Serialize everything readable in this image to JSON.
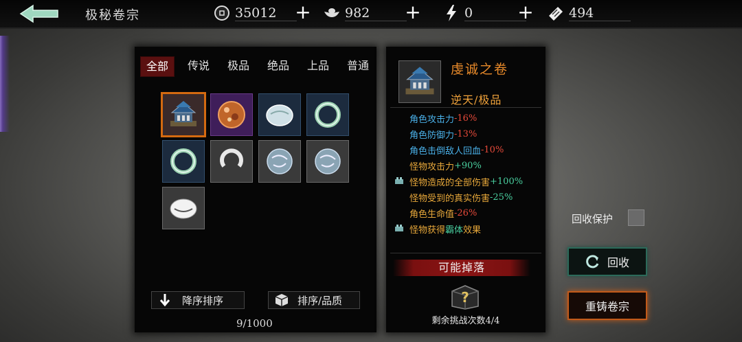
{
  "header": {
    "title": "极秘卷宗",
    "back_icon": "back-arrow-icon",
    "resources": [
      {
        "icon": "coin-icon",
        "value": "35012"
      },
      {
        "icon": "silver-ingot-icon",
        "value": "982"
      },
      {
        "icon": "lightning-icon",
        "value": "0"
      },
      {
        "icon": "ticket-icon",
        "value": "494"
      }
    ]
  },
  "inventory": {
    "tabs": [
      "全部",
      "传说",
      "极品",
      "绝品",
      "上品",
      "普通"
    ],
    "active_tab": "全部",
    "items": [
      {
        "type": "scroll",
        "quality": "legend",
        "selected": true
      },
      {
        "type": "orb",
        "quality": "purple"
      },
      {
        "type": "jade-pendant",
        "quality": "blue"
      },
      {
        "type": "jade-ring",
        "quality": "blue"
      },
      {
        "type": "jade-ring",
        "quality": "blue"
      },
      {
        "type": "silver-ring",
        "quality": "gray"
      },
      {
        "type": "stone",
        "quality": "gray"
      },
      {
        "type": "stone",
        "quality": "gray"
      },
      {
        "type": "white-pendant",
        "quality": "gray"
      }
    ],
    "sort_desc_label": "降序排序",
    "sort_quality_label": "排序/品质",
    "count": "9/1000"
  },
  "detail": {
    "name": "虔诚之卷",
    "quality": "逆天/极品",
    "attributes": [
      {
        "label": "角色攻击力",
        "value": "-16%",
        "label_color": "#4ab0e8",
        "value_color": "#e84a3a",
        "icon": false
      },
      {
        "label": "角色防御力",
        "value": "-13%",
        "label_color": "#4ab0e8",
        "value_color": "#e84a3a",
        "icon": false
      },
      {
        "label": "角色击倒敌人回血",
        "value": "-10%",
        "label_color": "#4ab0e8",
        "value_color": "#e84a3a",
        "icon": false
      },
      {
        "label": "怪物攻击力",
        "value": "+90%",
        "label_color": "#e8a83a",
        "value_color": "#4ad0a0",
        "icon": false
      },
      {
        "label": "怪物造成的全部伤害",
        "value": "+100%",
        "label_color": "#e8a83a",
        "value_color": "#4ad0a0",
        "icon": true
      },
      {
        "label": "怪物受到的真实伤害",
        "value": "-25%",
        "label_color": "#e8a83a",
        "value_color": "#4ad0a0",
        "icon": false
      },
      {
        "label": "角色生命值",
        "value": "-26%",
        "label_color": "#e8a83a",
        "value_color": "#e84a3a",
        "icon": false
      },
      {
        "label": "怪物获得",
        "value": "霸体",
        "suffix": "效果",
        "label_color": "#e8a83a",
        "value_color": "#4ad0a0",
        "icon": true
      }
    ],
    "drop_banner": "可能掉落",
    "remaining": "剩余挑战次数4/4"
  },
  "actions": {
    "protect_label": "回收保护",
    "recycle_label": "回收",
    "reforge_label": "重铸卷宗"
  }
}
